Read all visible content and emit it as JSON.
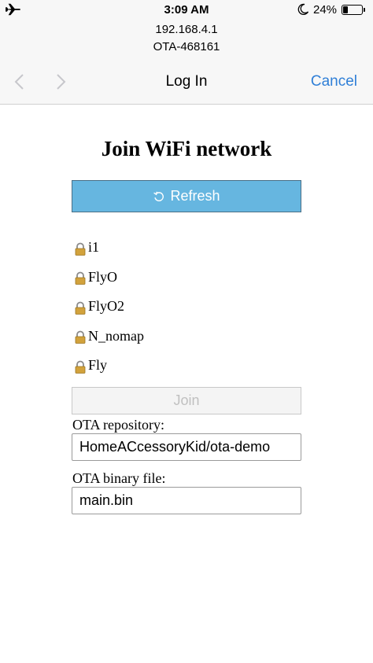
{
  "status_bar": {
    "time": "3:09 AM",
    "battery_percent": "24%",
    "battery_level": 0.24,
    "icons": [
      "airplane-icon",
      "moon-icon",
      "battery-icon"
    ]
  },
  "header": {
    "host": "192.168.4.1",
    "ssid": "OTA-468161",
    "title": "Log In",
    "cancel_label": "Cancel",
    "icons": [
      "chevron-left-icon",
      "chevron-right-icon"
    ]
  },
  "page": {
    "title": "Join WiFi network",
    "refresh_label": "Refresh",
    "join_label": "Join",
    "networks": [
      {
        "name": "i1"
      },
      {
        "name": "FlyO"
      },
      {
        "name": "FlyO2"
      },
      {
        "name": "N_nomap"
      },
      {
        "name": "Fly"
      }
    ],
    "repo_label": "OTA repository:",
    "repo_value": "HomeACcessoryKid/ota-demo",
    "binary_label": "OTA binary file:",
    "binary_value": "main.bin"
  },
  "colors": {
    "accent": "#2f7fd7",
    "refresh_button": "#66b6e0"
  }
}
